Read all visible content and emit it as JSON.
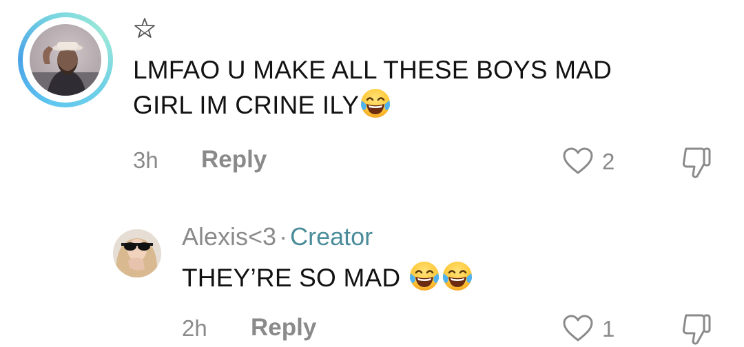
{
  "comments": [
    {
      "badge_icon": "star-outline-icon",
      "text_line1": "LMFAO U MAKE ALL THESE BOYS MAD",
      "text_line2": "GIRL IM CRINE ILY",
      "emoji": [
        "face-with-tears-of-joy"
      ],
      "time": "3h",
      "reply_label": "Reply",
      "likes": "2"
    },
    {
      "author": "Alexis<3",
      "separator": "·",
      "role_badge": "Creator",
      "text": "THEY’RE SO MAD ",
      "emoji": [
        "face-with-tears-of-joy",
        "face-with-tears-of-joy"
      ],
      "time": "2h",
      "reply_label": "Reply",
      "likes": "1"
    }
  ],
  "colors": {
    "creator_badge": "#4a8c99",
    "meta_gray": "#8a8a8a",
    "text": "#121212",
    "avatar_ring": "#5ec6f0"
  }
}
